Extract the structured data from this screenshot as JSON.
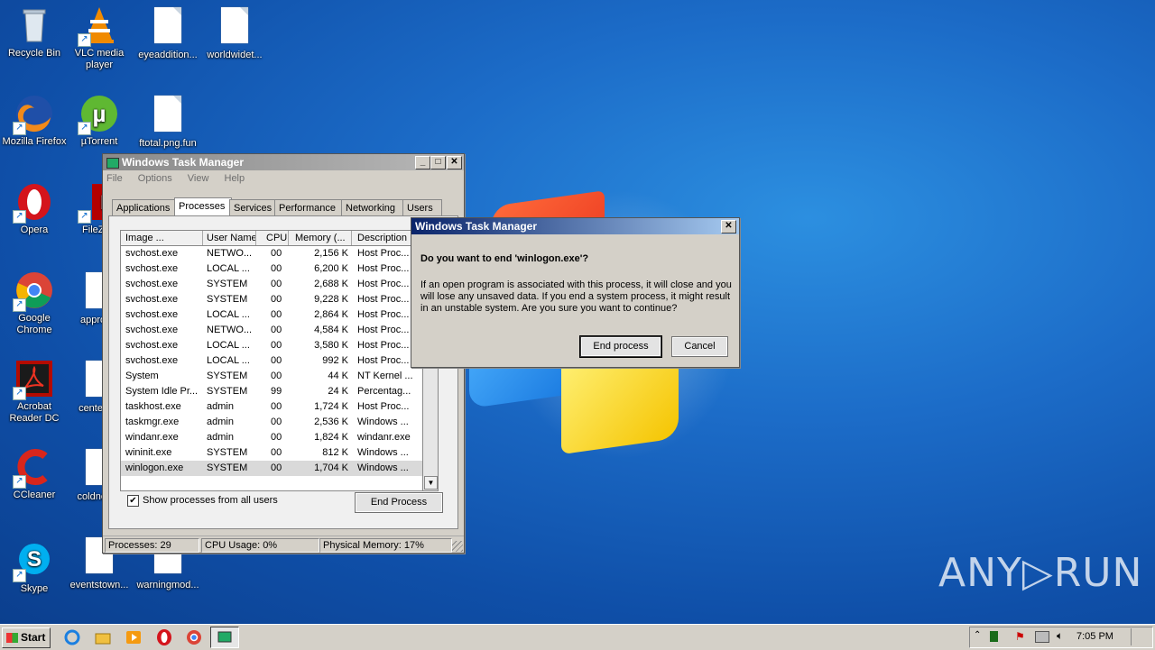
{
  "desktop": {
    "icons": [
      {
        "label": "Recycle Bin"
      },
      {
        "label": "VLC media player"
      },
      {
        "label": "eyeaddition..."
      },
      {
        "label": "worldwidet..."
      },
      {
        "label": "Mozilla Firefox"
      },
      {
        "label": "µTorrent"
      },
      {
        "label": "ftotal.png.fun"
      },
      {
        "label": "Opera"
      },
      {
        "label": "FileZilla"
      },
      {
        "label": "Google Chrome"
      },
      {
        "label": "approv..."
      },
      {
        "label": "Acrobat Reader DC"
      },
      {
        "label": "centerb..."
      },
      {
        "label": "CCleaner"
      },
      {
        "label": "coldnew..."
      },
      {
        "label": "Skype"
      },
      {
        "label": "eventstown..."
      },
      {
        "label": "warningmod..."
      }
    ],
    "watermark": "ANY▷RUN"
  },
  "task_manager": {
    "title": "Windows Task Manager",
    "menu": [
      "File",
      "Options",
      "View",
      "Help"
    ],
    "tabs": [
      "Applications",
      "Processes",
      "Services",
      "Performance",
      "Networking",
      "Users"
    ],
    "selected_tab": "Processes",
    "columns": [
      "Image ...",
      "User Name",
      "CPU",
      "Memory (...",
      "Description"
    ],
    "rows": [
      {
        "image": "svchost.exe",
        "user": "NETWO...",
        "cpu": "00",
        "mem": "2,156 K",
        "desc": "Host Proc..."
      },
      {
        "image": "svchost.exe",
        "user": "LOCAL ...",
        "cpu": "00",
        "mem": "6,200 K",
        "desc": "Host Proc..."
      },
      {
        "image": "svchost.exe",
        "user": "SYSTEM",
        "cpu": "00",
        "mem": "2,688 K",
        "desc": "Host Proc..."
      },
      {
        "image": "svchost.exe",
        "user": "SYSTEM",
        "cpu": "00",
        "mem": "9,228 K",
        "desc": "Host Proc..."
      },
      {
        "image": "svchost.exe",
        "user": "LOCAL ...",
        "cpu": "00",
        "mem": "2,864 K",
        "desc": "Host Proc..."
      },
      {
        "image": "svchost.exe",
        "user": "NETWO...",
        "cpu": "00",
        "mem": "4,584 K",
        "desc": "Host Proc..."
      },
      {
        "image": "svchost.exe",
        "user": "LOCAL ...",
        "cpu": "00",
        "mem": "3,580 K",
        "desc": "Host Proc..."
      },
      {
        "image": "svchost.exe",
        "user": "LOCAL ...",
        "cpu": "00",
        "mem": "992 K",
        "desc": "Host Proc..."
      },
      {
        "image": "System",
        "user": "SYSTEM",
        "cpu": "00",
        "mem": "44 K",
        "desc": "NT Kernel ..."
      },
      {
        "image": "System Idle Pr...",
        "user": "SYSTEM",
        "cpu": "99",
        "mem": "24 K",
        "desc": "Percentag..."
      },
      {
        "image": "taskhost.exe",
        "user": "admin",
        "cpu": "00",
        "mem": "1,724 K",
        "desc": "Host Proc..."
      },
      {
        "image": "taskmgr.exe",
        "user": "admin",
        "cpu": "00",
        "mem": "2,536 K",
        "desc": "Windows ..."
      },
      {
        "image": "windanr.exe",
        "user": "admin",
        "cpu": "00",
        "mem": "1,824 K",
        "desc": "windanr.exe"
      },
      {
        "image": "wininit.exe",
        "user": "SYSTEM",
        "cpu": "00",
        "mem": "812 K",
        "desc": "Windows ..."
      },
      {
        "image": "winlogon.exe",
        "user": "SYSTEM",
        "cpu": "00",
        "mem": "1,704 K",
        "desc": "Windows ..."
      }
    ],
    "selected_row": 14,
    "show_all_label": "Show processes from all users",
    "show_all_checked": true,
    "end_process_label": "End Process",
    "status": {
      "processes": "Processes: 29",
      "cpu": "CPU Usage: 0%",
      "memory": "Physical Memory: 17%"
    }
  },
  "dialog": {
    "title": "Windows Task Manager",
    "question": "Do you want to end 'winlogon.exe'?",
    "body": "If an open program is associated with this process, it will close and you will lose any unsaved data. If you end a system process, it might result in an unstable system. Are you sure you want to continue?",
    "confirm_label": "End process",
    "cancel_label": "Cancel",
    "close_glyph": "✕"
  },
  "taskbar": {
    "start_label": "Start",
    "time": "7:05 PM"
  }
}
